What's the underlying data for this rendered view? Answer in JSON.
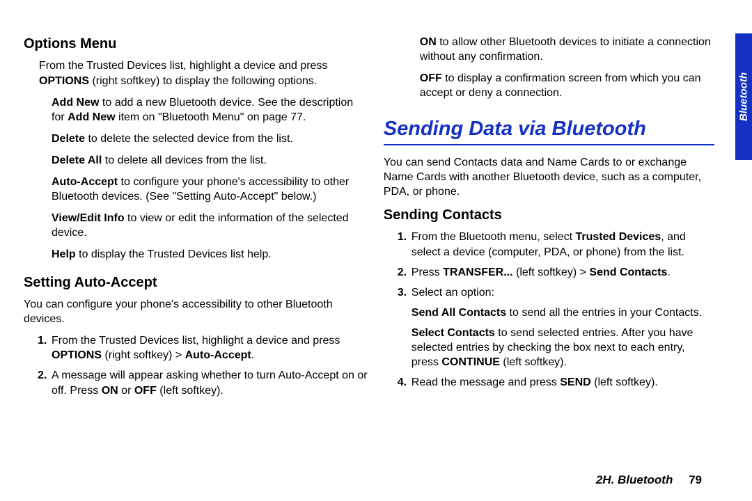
{
  "sideTab": "Bluetooth",
  "left": {
    "h_options": "Options Menu",
    "p_intro_a": "From the Trusted Devices list, highlight a device and press ",
    "p_intro_b": "OPTIONS",
    "p_intro_c": " (right softkey) to display the following options.",
    "addnew_a": "Add New",
    "addnew_b": " to add a new Bluetooth device. See the description for ",
    "addnew_c": "Add New",
    "addnew_d": " item on \"Bluetooth Menu\" on page 77.",
    "delete_a": "Delete",
    "delete_b": " to delete the selected device from the list.",
    "deleteall_a": "Delete All",
    "deleteall_b": " to delete all devices from the list.",
    "autoacc_a": "Auto-Accept",
    "autoacc_b": " to configure your phone's accessibility to other Bluetooth devices. (See \"Setting Auto-Accept\" below.)",
    "view_a": "View/Edit Info",
    "view_b": " to view or edit the information of the selected device.",
    "help_a": "Help",
    "help_b": " to display the Trusted Devices list help.",
    "h_setting": "Setting Auto-Accept",
    "p_setting": "You can configure your phone's accessibility to other Bluetooth devices.",
    "s1_a": "From the Trusted Devices list, highlight a device and press ",
    "s1_b": "OPTIONS",
    "s1_c": " (right softkey) > ",
    "s1_d": "Auto-Accept",
    "s1_e": ".",
    "s2_a": "A message will appear asking whether to turn Auto-Accept on or off. Press ",
    "s2_b": "ON",
    "s2_c": " or ",
    "s2_d": "OFF",
    "s2_e": " (left softkey).",
    "n1": "1.",
    "n2": "2."
  },
  "right": {
    "on_a": "ON",
    "on_b": " to allow other Bluetooth devices to initiate a connection without any confirmation.",
    "off_a": "OFF",
    "off_b": " to display a confirmation screen from which you can accept or deny a connection.",
    "h_main": "Sending Data via Bluetooth",
    "p_main": "You can send Contacts data and Name Cards to or exchange Name Cards with another Bluetooth device, such as a computer, PDA, or phone.",
    "h_contacts": "Sending Contacts",
    "c1_a": "From the Bluetooth menu, select ",
    "c1_b": "Trusted Devices",
    "c1_c": ", and select a device (computer, PDA, or phone) from the list.",
    "c2_a": "Press ",
    "c2_b": "TRANSFER...",
    "c2_c": " (left softkey) > ",
    "c2_d": "Send Contacts",
    "c2_e": ".",
    "c3": "Select an option:",
    "sendall_a": "Send All Contacts",
    "sendall_b": " to send all the entries in your Contacts.",
    "selcon_a": "Select Contacts",
    "selcon_b": " to send selected entries. After you have selected entries by checking the box next to each entry, press ",
    "selcon_c": "CONTINUE",
    "selcon_d": " (left softkey).",
    "c4_a": "Read the message and press ",
    "c4_b": "SEND",
    "c4_c": " (left softkey).",
    "n1": "1.",
    "n2": "2.",
    "n3": "3.",
    "n4": "4."
  },
  "footer": {
    "section": "2H. Bluetooth",
    "page": "79"
  }
}
